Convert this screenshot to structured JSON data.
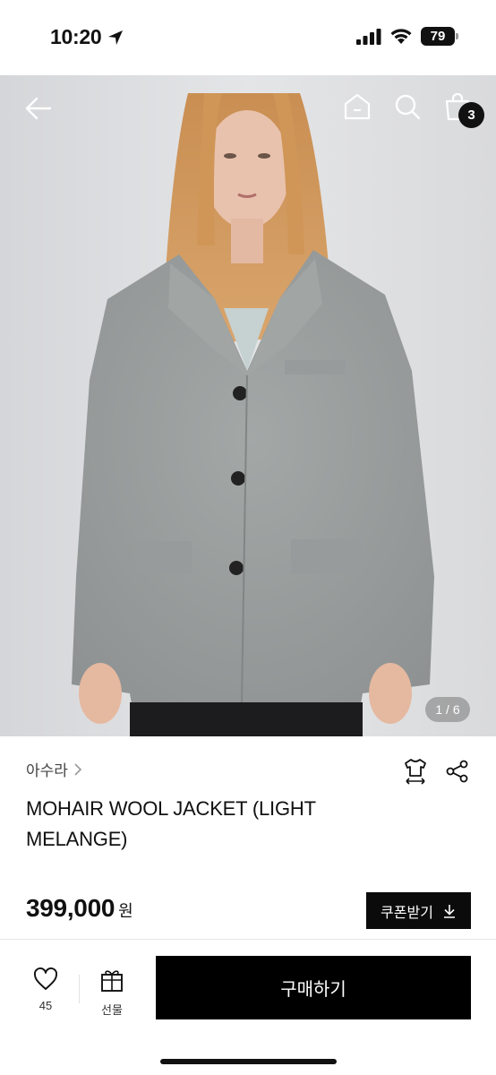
{
  "status_bar": {
    "time": "10:20",
    "battery": "79"
  },
  "header": {
    "cart_count": "3"
  },
  "gallery": {
    "pager": "1 / 6"
  },
  "product": {
    "brand": "아수라",
    "title": "MOHAIR WOOL JACKET (LIGHT MELANGE)",
    "price": "399,000",
    "price_unit": "원",
    "coupon_label": "쿠폰받기"
  },
  "bottom_bar": {
    "like_count": "45",
    "gift_label": "선물",
    "buy_label": "구매하기"
  },
  "colors": {
    "accent": "#000000",
    "background": "#ffffff"
  },
  "icons": [
    "location-arrow-icon",
    "signal-icon",
    "wifi-icon",
    "battery-icon",
    "back-arrow-icon",
    "home-icon",
    "search-icon",
    "shopping-bag-icon",
    "chevron-right-icon",
    "size-guide-icon",
    "share-icon",
    "download-icon",
    "heart-icon",
    "gift-icon"
  ]
}
